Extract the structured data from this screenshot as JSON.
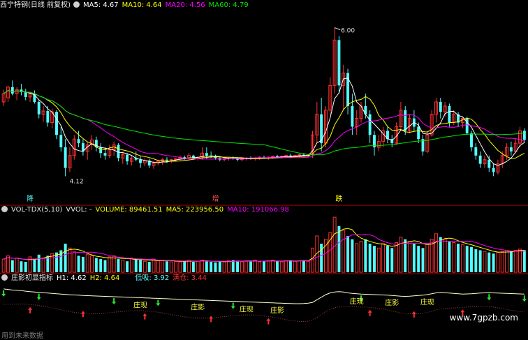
{
  "header1": {
    "stock": "西宁特钢(日线 前复权)",
    "ma5": "MA5: 4.67",
    "ma10": "MA10: 4.64",
    "ma20": "MA20: 4.56",
    "ma60": "MA60: 4.79"
  },
  "header2": {
    "name": "VOL-TDX(5,10)",
    "vvol": "VVOL: -",
    "volume": "VOLUME: 89461.51",
    "ma5": "MA5: 223956.50",
    "ma10": "MA10: 191066.98"
  },
  "header3": {
    "name": "庄影初显指标",
    "h1": "H1: 4.62",
    "h2": "H2: 4.64",
    "low": "低吸: 3.92",
    "full": "满仓: 3.44"
  },
  "watermark": "www.7gpzb.com",
  "footer": "用到未来数据",
  "colors": {
    "up": "#ff3232",
    "down": "#54fcfc",
    "ma5": "#ffffff",
    "ma10": "#ffff00",
    "ma20": "#ff00ff",
    "ma60": "#00e600",
    "bg": "#000000",
    "divider": "#b00000"
  },
  "chart_data": {
    "type": "candlestick",
    "price_labels": {
      "high": "6.00",
      "low": "4.12"
    },
    "price_ylim": [
      4.0,
      6.2
    ],
    "signal_labels": [
      "降",
      "增",
      "跌"
    ],
    "indicator_labels": [
      "庄现",
      "庄影",
      "庄现",
      "庄影",
      "庄现",
      "庄影",
      "庄现"
    ],
    "candles": [
      {
        "o": 5.1,
        "h": 5.25,
        "l": 5.05,
        "c": 5.2
      },
      {
        "o": 5.15,
        "h": 5.3,
        "l": 5.1,
        "c": 5.28
      },
      {
        "o": 5.28,
        "h": 5.36,
        "l": 5.18,
        "c": 5.2
      },
      {
        "o": 5.2,
        "h": 5.28,
        "l": 5.12,
        "c": 5.25
      },
      {
        "o": 5.25,
        "h": 5.32,
        "l": 5.18,
        "c": 5.22
      },
      {
        "o": 5.22,
        "h": 5.26,
        "l": 5.12,
        "c": 5.16
      },
      {
        "o": 5.16,
        "h": 5.22,
        "l": 5.1,
        "c": 5.2
      },
      {
        "o": 5.2,
        "h": 5.24,
        "l": 5.08,
        "c": 5.1
      },
      {
        "o": 5.1,
        "h": 5.12,
        "l": 4.9,
        "c": 4.95
      },
      {
        "o": 4.95,
        "h": 5.05,
        "l": 4.86,
        "c": 4.99
      },
      {
        "o": 4.99,
        "h": 5.05,
        "l": 4.8,
        "c": 4.85
      },
      {
        "o": 4.85,
        "h": 5.02,
        "l": 4.78,
        "c": 4.98
      },
      {
        "o": 4.98,
        "h": 5.0,
        "l": 4.65,
        "c": 4.7
      },
      {
        "o": 4.7,
        "h": 4.8,
        "l": 4.5,
        "c": 4.55
      },
      {
        "o": 4.55,
        "h": 4.65,
        "l": 4.2,
        "c": 4.3
      },
      {
        "o": 4.3,
        "h": 4.55,
        "l": 4.25,
        "c": 4.45
      },
      {
        "o": 4.45,
        "h": 4.7,
        "l": 4.4,
        "c": 4.65
      },
      {
        "o": 4.65,
        "h": 4.75,
        "l": 4.55,
        "c": 4.6
      },
      {
        "o": 4.6,
        "h": 4.65,
        "l": 4.45,
        "c": 4.5
      },
      {
        "o": 4.5,
        "h": 4.62,
        "l": 4.4,
        "c": 4.58
      },
      {
        "o": 4.58,
        "h": 4.7,
        "l": 4.52,
        "c": 4.64
      },
      {
        "o": 4.64,
        "h": 4.68,
        "l": 4.5,
        "c": 4.55
      },
      {
        "o": 4.55,
        "h": 4.6,
        "l": 4.42,
        "c": 4.48
      },
      {
        "o": 4.48,
        "h": 4.55,
        "l": 4.4,
        "c": 4.45
      },
      {
        "o": 4.45,
        "h": 4.58,
        "l": 4.42,
        "c": 4.52
      },
      {
        "o": 4.52,
        "h": 4.62,
        "l": 4.45,
        "c": 4.58
      },
      {
        "o": 4.58,
        "h": 4.6,
        "l": 4.38,
        "c": 4.42
      },
      {
        "o": 4.42,
        "h": 4.5,
        "l": 4.35,
        "c": 4.46
      },
      {
        "o": 4.46,
        "h": 4.48,
        "l": 4.34,
        "c": 4.38
      },
      {
        "o": 4.38,
        "h": 4.45,
        "l": 4.33,
        "c": 4.42
      },
      {
        "o": 4.42,
        "h": 4.5,
        "l": 4.38,
        "c": 4.4
      },
      {
        "o": 4.4,
        "h": 4.44,
        "l": 4.3,
        "c": 4.36
      },
      {
        "o": 4.36,
        "h": 4.42,
        "l": 4.32,
        "c": 4.39
      },
      {
        "o": 4.39,
        "h": 4.41,
        "l": 4.3,
        "c": 4.33
      },
      {
        "o": 4.33,
        "h": 4.38,
        "l": 4.29,
        "c": 4.36
      },
      {
        "o": 4.36,
        "h": 4.4,
        "l": 4.33,
        "c": 4.38
      },
      {
        "o": 4.38,
        "h": 4.42,
        "l": 4.34,
        "c": 4.4
      },
      {
        "o": 4.4,
        "h": 4.43,
        "l": 4.36,
        "c": 4.39
      },
      {
        "o": 4.39,
        "h": 4.41,
        "l": 4.36,
        "c": 4.4
      },
      {
        "o": 4.4,
        "h": 4.42,
        "l": 4.38,
        "c": 4.41
      },
      {
        "o": 4.41,
        "h": 4.45,
        "l": 4.38,
        "c": 4.43
      },
      {
        "o": 4.43,
        "h": 4.45,
        "l": 4.4,
        "c": 4.42
      },
      {
        "o": 4.42,
        "h": 4.48,
        "l": 4.4,
        "c": 4.45
      },
      {
        "o": 4.45,
        "h": 4.46,
        "l": 4.4,
        "c": 4.41
      },
      {
        "o": 4.41,
        "h": 4.44,
        "l": 4.39,
        "c": 4.43
      },
      {
        "o": 4.43,
        "h": 4.55,
        "l": 4.4,
        "c": 4.48
      },
      {
        "o": 4.48,
        "h": 4.55,
        "l": 4.41,
        "c": 4.45
      },
      {
        "o": 4.45,
        "h": 4.5,
        "l": 4.42,
        "c": 4.44
      },
      {
        "o": 4.44,
        "h": 4.46,
        "l": 4.4,
        "c": 4.42
      },
      {
        "o": 4.42,
        "h": 4.44,
        "l": 4.38,
        "c": 4.4
      },
      {
        "o": 4.4,
        "h": 4.42,
        "l": 4.38,
        "c": 4.41
      },
      {
        "o": 4.41,
        "h": 4.43,
        "l": 4.39,
        "c": 4.42
      },
      {
        "o": 4.42,
        "h": 4.44,
        "l": 4.4,
        "c": 4.41
      },
      {
        "o": 4.41,
        "h": 4.43,
        "l": 4.38,
        "c": 4.4
      },
      {
        "o": 4.4,
        "h": 4.42,
        "l": 4.38,
        "c": 4.41
      },
      {
        "o": 4.41,
        "h": 4.43,
        "l": 4.39,
        "c": 4.42
      },
      {
        "o": 4.42,
        "h": 4.44,
        "l": 4.4,
        "c": 4.41
      },
      {
        "o": 4.41,
        "h": 4.43,
        "l": 4.39,
        "c": 4.42
      },
      {
        "o": 4.42,
        "h": 4.44,
        "l": 4.4,
        "c": 4.43
      },
      {
        "o": 4.43,
        "h": 4.45,
        "l": 4.41,
        "c": 4.42
      },
      {
        "o": 4.42,
        "h": 4.44,
        "l": 4.4,
        "c": 4.43
      },
      {
        "o": 4.43,
        "h": 4.45,
        "l": 4.41,
        "c": 4.44
      },
      {
        "o": 4.44,
        "h": 4.46,
        "l": 4.42,
        "c": 4.43
      },
      {
        "o": 4.43,
        "h": 4.45,
        "l": 4.41,
        "c": 4.44
      },
      {
        "o": 4.44,
        "h": 4.46,
        "l": 4.42,
        "c": 4.45
      },
      {
        "o": 4.45,
        "h": 4.47,
        "l": 4.43,
        "c": 4.44
      },
      {
        "o": 4.44,
        "h": 4.46,
        "l": 4.42,
        "c": 4.45
      },
      {
        "o": 4.45,
        "h": 4.47,
        "l": 4.43,
        "c": 4.46
      },
      {
        "o": 4.46,
        "h": 4.48,
        "l": 4.44,
        "c": 4.45
      },
      {
        "o": 4.45,
        "h": 4.47,
        "l": 4.43,
        "c": 4.46
      },
      {
        "o": 4.46,
        "h": 4.75,
        "l": 4.42,
        "c": 4.7
      },
      {
        "o": 4.7,
        "h": 5.1,
        "l": 4.6,
        "c": 4.95
      },
      {
        "o": 4.95,
        "h": 5.15,
        "l": 4.5,
        "c": 4.6
      },
      {
        "o": 4.6,
        "h": 5.05,
        "l": 4.55,
        "c": 5.0
      },
      {
        "o": 5.0,
        "h": 5.4,
        "l": 4.95,
        "c": 5.3
      },
      {
        "o": 5.3,
        "h": 6.0,
        "l": 5.2,
        "c": 5.85
      },
      {
        "o": 5.85,
        "h": 5.9,
        "l": 5.2,
        "c": 5.3
      },
      {
        "o": 5.3,
        "h": 5.55,
        "l": 5.0,
        "c": 5.45
      },
      {
        "o": 5.45,
        "h": 5.5,
        "l": 4.95,
        "c": 5.05
      },
      {
        "o": 5.05,
        "h": 5.2,
        "l": 4.7,
        "c": 4.8
      },
      {
        "o": 4.8,
        "h": 5.0,
        "l": 4.7,
        "c": 4.9
      },
      {
        "o": 4.9,
        "h": 5.1,
        "l": 4.85,
        "c": 5.05
      },
      {
        "o": 5.05,
        "h": 5.2,
        "l": 4.9,
        "c": 4.95
      },
      {
        "o": 4.95,
        "h": 5.0,
        "l": 4.6,
        "c": 4.7
      },
      {
        "o": 4.7,
        "h": 4.75,
        "l": 4.45,
        "c": 4.55
      },
      {
        "o": 4.55,
        "h": 4.7,
        "l": 4.5,
        "c": 4.62
      },
      {
        "o": 4.62,
        "h": 4.8,
        "l": 4.55,
        "c": 4.75
      },
      {
        "o": 4.75,
        "h": 4.8,
        "l": 4.6,
        "c": 4.65
      },
      {
        "o": 4.65,
        "h": 4.7,
        "l": 4.55,
        "c": 4.6
      },
      {
        "o": 4.6,
        "h": 4.85,
        "l": 4.58,
        "c": 4.8
      },
      {
        "o": 4.8,
        "h": 5.1,
        "l": 4.75,
        "c": 5.0
      },
      {
        "o": 5.0,
        "h": 5.05,
        "l": 4.7,
        "c": 4.75
      },
      {
        "o": 4.75,
        "h": 4.95,
        "l": 4.72,
        "c": 4.9
      },
      {
        "o": 4.9,
        "h": 5.0,
        "l": 4.75,
        "c": 4.8
      },
      {
        "o": 4.8,
        "h": 4.85,
        "l": 4.6,
        "c": 4.65
      },
      {
        "o": 4.65,
        "h": 4.7,
        "l": 4.45,
        "c": 4.5
      },
      {
        "o": 4.5,
        "h": 4.75,
        "l": 4.48,
        "c": 4.7
      },
      {
        "o": 4.7,
        "h": 5.0,
        "l": 4.68,
        "c": 4.95
      },
      {
        "o": 4.95,
        "h": 5.15,
        "l": 4.85,
        "c": 5.1
      },
      {
        "o": 5.1,
        "h": 5.15,
        "l": 4.9,
        "c": 4.98
      },
      {
        "o": 4.98,
        "h": 5.1,
        "l": 4.92,
        "c": 5.05
      },
      {
        "o": 5.05,
        "h": 5.08,
        "l": 4.8,
        "c": 4.85
      },
      {
        "o": 4.85,
        "h": 5.0,
        "l": 4.82,
        "c": 4.95
      },
      {
        "o": 4.95,
        "h": 4.98,
        "l": 4.8,
        "c": 4.85
      },
      {
        "o": 4.85,
        "h": 4.92,
        "l": 4.78,
        "c": 4.9
      },
      {
        "o": 4.9,
        "h": 4.92,
        "l": 4.7,
        "c": 4.72
      },
      {
        "o": 4.72,
        "h": 4.75,
        "l": 4.5,
        "c": 4.55
      },
      {
        "o": 4.55,
        "h": 4.6,
        "l": 4.4,
        "c": 4.45
      },
      {
        "o": 4.45,
        "h": 4.5,
        "l": 4.3,
        "c": 4.35
      },
      {
        "o": 4.35,
        "h": 4.45,
        "l": 4.3,
        "c": 4.4
      },
      {
        "o": 4.4,
        "h": 4.45,
        "l": 4.25,
        "c": 4.3
      },
      {
        "o": 4.3,
        "h": 4.35,
        "l": 4.2,
        "c": 4.25
      },
      {
        "o": 4.25,
        "h": 4.4,
        "l": 4.22,
        "c": 4.35
      },
      {
        "o": 4.35,
        "h": 4.5,
        "l": 4.3,
        "c": 4.45
      },
      {
        "o": 4.45,
        "h": 4.6,
        "l": 4.4,
        "c": 4.55
      },
      {
        "o": 4.55,
        "h": 4.62,
        "l": 4.45,
        "c": 4.5
      },
      {
        "o": 4.5,
        "h": 4.65,
        "l": 4.48,
        "c": 4.6
      },
      {
        "o": 4.6,
        "h": 4.8,
        "l": 4.55,
        "c": 4.75
      },
      {
        "o": 4.75,
        "h": 4.78,
        "l": 4.6,
        "c": 4.64
      }
    ],
    "volume": [
      120,
      150,
      110,
      130,
      100,
      95,
      140,
      120,
      160,
      130,
      150,
      170,
      180,
      200,
      260,
      220,
      190,
      150,
      140,
      160,
      150,
      130,
      120,
      110,
      140,
      150,
      120,
      110,
      100,
      130,
      120,
      110,
      100,
      95,
      120,
      105,
      110,
      100,
      95,
      100,
      95,
      105,
      110,
      95,
      100,
      110,
      105,
      95,
      90,
      100,
      95,
      105,
      110,
      100,
      95,
      100,
      105,
      110,
      95,
      100,
      105,
      110,
      100,
      95,
      105,
      110,
      100,
      105,
      110,
      100,
      220,
      330,
      260,
      300,
      360,
      500,
      420,
      380,
      330,
      300,
      260,
      280,
      300,
      260,
      240,
      220,
      260,
      240,
      220,
      270,
      320,
      300,
      280,
      260,
      240,
      220,
      260,
      300,
      350,
      320,
      300,
      280,
      270,
      260,
      250,
      240,
      230,
      210,
      200,
      190,
      180,
      170,
      180,
      190,
      200,
      190,
      200,
      210,
      200
    ],
    "volume_ylim": [
      0,
      520
    ],
    "indicator_ylim": [
      3.0,
      5.6
    ],
    "indicator_line": [
      5.28,
      5.25,
      5.22,
      5.2,
      5.18,
      5.15,
      5.12,
      5.1,
      5.08,
      5.06,
      5.04,
      5.02,
      5.0,
      4.98,
      4.96,
      4.94,
      4.93,
      4.92,
      4.9,
      4.89,
      4.88,
      4.87,
      4.86,
      4.85,
      4.84,
      4.83,
      4.82,
      4.81,
      4.8,
      4.79,
      4.78,
      4.77,
      4.76,
      4.75,
      4.74,
      4.73,
      4.72,
      4.71,
      4.7,
      4.69,
      4.68,
      4.67,
      4.66,
      4.65,
      4.64,
      4.63,
      4.62,
      4.61,
      4.6,
      4.59,
      4.58,
      4.57,
      4.56,
      4.55,
      4.54,
      4.53,
      4.52,
      4.51,
      4.5,
      4.49,
      4.48,
      4.47,
      4.46,
      4.45,
      4.44,
      4.43,
      4.42,
      4.42,
      4.43,
      4.45,
      4.5,
      4.65,
      4.8,
      4.95,
      5.05,
      5.1,
      5.12,
      5.1,
      5.05,
      5.02,
      5.0,
      4.98,
      4.97,
      4.96,
      4.95,
      4.94,
      4.93,
      4.92,
      4.9,
      4.88,
      4.86,
      4.85,
      4.86,
      4.88,
      4.9,
      4.92,
      4.95,
      5.0,
      5.05,
      5.08,
      5.06,
      5.04,
      5.02,
      5.0,
      4.98,
      4.99,
      5.0,
      5.02,
      5.04,
      5.05,
      5.06,
      5.05,
      5.04,
      5.03,
      5.02,
      5.01,
      5.0,
      4.99,
      4.98
    ],
    "up_arrows": [
      6,
      18,
      32,
      47,
      60,
      83,
      93,
      104,
      124,
      148
    ],
    "down_arrows": [
      0,
      8,
      25,
      35,
      52,
      81,
      110,
      118,
      140
    ],
    "marker_labels": [
      {
        "i": 31,
        "t": 0
      },
      {
        "i": 44,
        "t": 1
      },
      {
        "i": 55,
        "t": 2
      },
      {
        "i": 62,
        "t": 3
      },
      {
        "i": 80,
        "t": 4
      },
      {
        "i": 88,
        "t": 5
      },
      {
        "i": 96,
        "t": 6
      }
    ]
  }
}
